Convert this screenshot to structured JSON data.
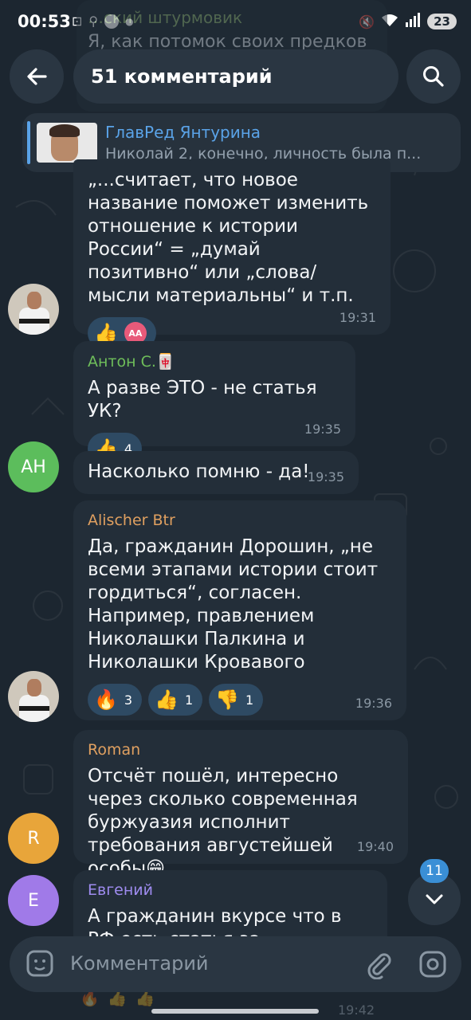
{
  "status_bar": {
    "time": "00:53",
    "battery": "23",
    "icons": [
      "screenshot-icon",
      "search-icon",
      "app-icon",
      "dot-icon"
    ],
    "right_icons": [
      "mute-icon",
      "wifi-icon",
      "signal-icon",
      "battery-icon"
    ]
  },
  "background_message": {
    "author": "…ский штурмовик",
    "text": "Я, как потомок своих предков"
  },
  "header": {
    "title": "51 комментарий",
    "back_icon": "arrow-left-icon",
    "search_icon": "search-icon"
  },
  "pinned": {
    "title": "ГлавРед Янтурина",
    "text": "Николай 2, конечно, личность была п..."
  },
  "messages": [
    {
      "text": "„...считает, что новое название поможет изменить отношение к истории России“ = „думай позитивно“ или „слова/мысли материальны“ и т.п.",
      "time": "19:31",
      "reactions": [
        {
          "emoji": "👍",
          "badge": "AA"
        }
      ]
    },
    {
      "author": "Антон С.",
      "author_badge": "🀄",
      "text": "А разве ЭТО - не статья УК?",
      "time": "19:35",
      "reactions": [
        {
          "emoji": "👍",
          "count": "4"
        }
      ]
    },
    {
      "avatar": "АН",
      "text": "Насколько помню - да!",
      "time": "19:35"
    },
    {
      "author": "Alischer Btr",
      "text": "Да, гражданин Дорошин, „не всеми этапами истории стоит гордиться“, согласен. Например, правлением Николашки Палкина и Николашки Кровавого",
      "time": "19:36",
      "reactions": [
        {
          "emoji": "🔥",
          "count": "3"
        },
        {
          "emoji": "👍",
          "count": "1"
        },
        {
          "emoji": "👎",
          "count": "1"
        }
      ]
    },
    {
      "avatar": "R",
      "author": "Roman",
      "text": "Отсчёт пошёл, интересно через сколько современная буржуазия исполнит требования августейшей особы",
      "text_emoji": "😁",
      "time": "19:40"
    },
    {
      "avatar": "E",
      "author": "Евгений",
      "text": "А гражданин вкурсе что в РФ есть статья за приравнивание"
    }
  ],
  "scroll": {
    "unread": "11"
  },
  "composer": {
    "placeholder": "Комментарий"
  },
  "behind_time": "19:42",
  "colors": {
    "background": "#1c2630",
    "bubble": "#232e39",
    "accent": "#5aa3e8",
    "author_anton": "#6fbf5a",
    "author_alischer": "#e0a060",
    "author_roman": "#e0a060",
    "author_evgeniy": "#9f8cf0",
    "avatar_ah": "#5cbd5c",
    "avatar_r": "#e8a53a",
    "avatar_e": "#a07ae8"
  }
}
